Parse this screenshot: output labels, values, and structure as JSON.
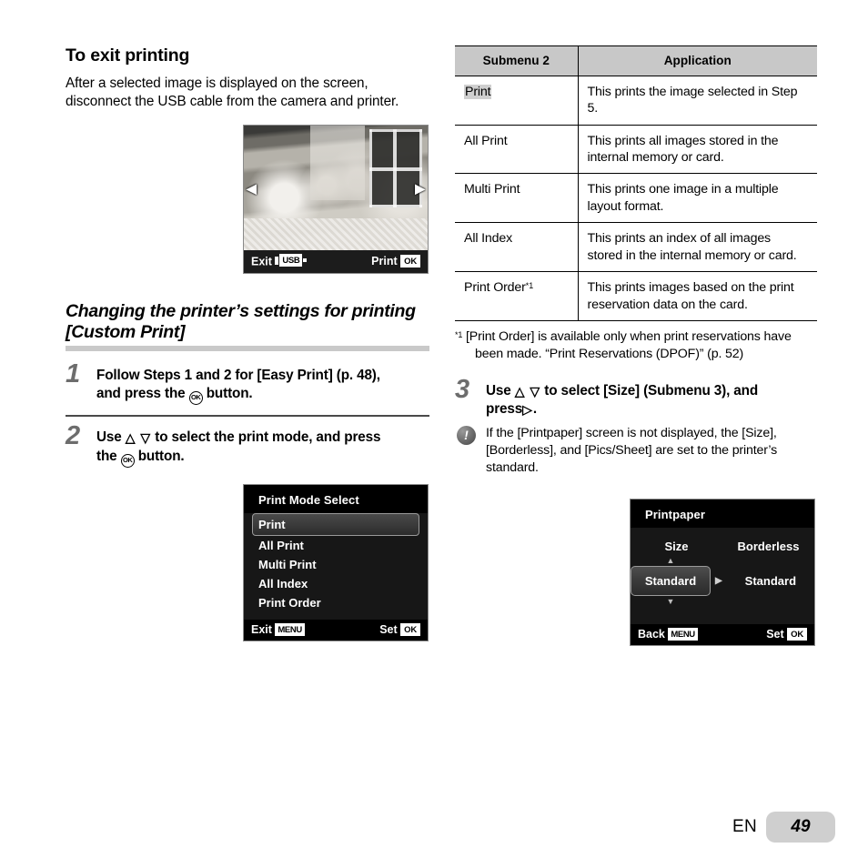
{
  "left": {
    "section_title": "To exit printing",
    "body_text": "After a selected image is displayed on the screen, disconnect the USB cable from the camera and printer.",
    "photo_screen": {
      "nav_left": "◀",
      "nav_right": "▶",
      "exit_label": "Exit",
      "usb_label": "USB",
      "print_label": "Print",
      "ok_label": "OK"
    },
    "italic_heading": "Changing the printer’s settings for printing [Custom Print]",
    "step1": {
      "number": "1",
      "line1": "Follow Steps 1 and 2 for [Easy Print] (p. 48),",
      "line2_pre": "and press the",
      "line2_post": "button."
    },
    "step2": {
      "number": "2",
      "line1_pre": "Use",
      "line1_arrows": "△ ▽",
      "line1_post": "to select the print mode, and press",
      "line2_pre": "the",
      "line2_post": "button."
    },
    "print_mode_screen": {
      "title": "Print Mode Select",
      "items": [
        "Print",
        "All Print",
        "Multi Print",
        "All Index",
        "Print Order"
      ],
      "selected_index": 0,
      "exit_label": "Exit",
      "menu_label": "MENU",
      "set_label": "Set",
      "ok_label": "OK"
    }
  },
  "right": {
    "table": {
      "headers": [
        "Submenu 2",
        "Application"
      ],
      "rows": [
        {
          "submenu": "Print",
          "highlighted": true,
          "footnote": "",
          "application": "This prints the image selected in Step 5."
        },
        {
          "submenu": "All Print",
          "highlighted": false,
          "footnote": "",
          "application": "This prints all images stored in the internal memory or card."
        },
        {
          "submenu": "Multi Print",
          "highlighted": false,
          "footnote": "",
          "application": "This prints one image in a multiple layout format."
        },
        {
          "submenu": "All Index",
          "highlighted": false,
          "footnote": "",
          "application": "This prints an index of all images stored in the internal memory or card."
        },
        {
          "submenu": "Print Order",
          "highlighted": false,
          "footnote": "*1",
          "application": "This prints images based on the print reservation data on the card."
        }
      ]
    },
    "footnote": {
      "marker": "*1",
      "text": "[Print Order] is available only when print reservations have been made. “Print Reservations (DPOF)” (p. 52)"
    },
    "step3": {
      "number": "3",
      "line1_pre": "Use",
      "line1_arrows": "△ ▽",
      "line1_post": "to select [Size] (Submenu 3), and",
      "line2_pre": "press",
      "line2_arrow": "▷",
      "line2_post": "."
    },
    "note": {
      "icon": "!",
      "text": "If the [Printpaper] screen is not displayed, the [Size], [Borderless], and [Pics/Sheet] are set to the printer’s standard."
    },
    "printpaper_screen": {
      "title": "Printpaper",
      "col1_header": "Size",
      "col2_header": "Borderless",
      "col1_value": "Standard",
      "col2_value": "Standard",
      "arrow_up": "▲",
      "arrow_down": "▼",
      "caret": "▶",
      "back_label": "Back",
      "menu_label": "MENU",
      "set_label": "Set",
      "ok_label": "OK"
    }
  },
  "footer": {
    "language": "EN",
    "page_number": "49"
  }
}
